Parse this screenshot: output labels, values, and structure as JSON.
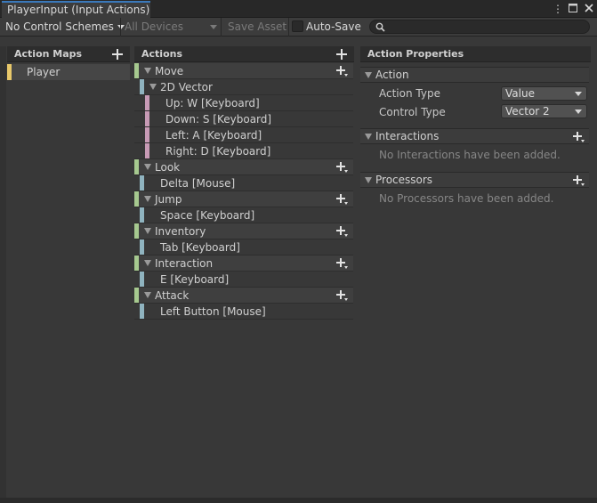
{
  "window": {
    "tab_title": "PlayerInput (Input Actions)",
    "icons": [
      "more-vert-icon",
      "maximize-icon",
      "close-icon"
    ]
  },
  "toolbar": {
    "control_scheme": "No Control Schemes",
    "devices": "All Devices",
    "save_asset": "Save Asset",
    "auto_save_label": "Auto-Save",
    "auto_save_checked": false,
    "search_placeholder": ""
  },
  "action_maps": {
    "title": "Action Maps",
    "items": [
      {
        "label": "Player",
        "selected": true
      }
    ]
  },
  "actions": {
    "title": "Actions",
    "rows": [
      {
        "label": "Move",
        "kind": "action"
      },
      {
        "label": "2D Vector",
        "kind": "composite"
      },
      {
        "label": "Up: W [Keyboard]",
        "kind": "part"
      },
      {
        "label": "Down: S [Keyboard]",
        "kind": "part"
      },
      {
        "label": "Left: A [Keyboard]",
        "kind": "part"
      },
      {
        "label": "Right: D [Keyboard]",
        "kind": "part"
      },
      {
        "label": "Look",
        "kind": "action"
      },
      {
        "label": "Delta [Mouse]",
        "kind": "binding"
      },
      {
        "label": "Jump",
        "kind": "action"
      },
      {
        "label": "Space [Keyboard]",
        "kind": "binding"
      },
      {
        "label": "Inventory",
        "kind": "action"
      },
      {
        "label": "Tab [Keyboard]",
        "kind": "binding"
      },
      {
        "label": "Interaction",
        "kind": "action"
      },
      {
        "label": "E [Keyboard]",
        "kind": "binding"
      },
      {
        "label": "Attack",
        "kind": "action"
      },
      {
        "label": "Left Button [Mouse]",
        "kind": "binding"
      }
    ]
  },
  "properties": {
    "title": "Action Properties",
    "action_section": "Action",
    "action_type_label": "Action Type",
    "action_type_value": "Value",
    "control_type_label": "Control Type",
    "control_type_value": "Vector 2",
    "interactions_section": "Interactions",
    "interactions_empty": "No Interactions have been added.",
    "processors_section": "Processors",
    "processors_empty": "No Processors have been added."
  },
  "colors": {
    "action_indicator": "#a6c98f",
    "binding_indicator": "#8fb3bf",
    "part_indicator": "#c79ab5",
    "map_indicator": "#e8c86a",
    "tab_accent": "#3a79bb"
  }
}
